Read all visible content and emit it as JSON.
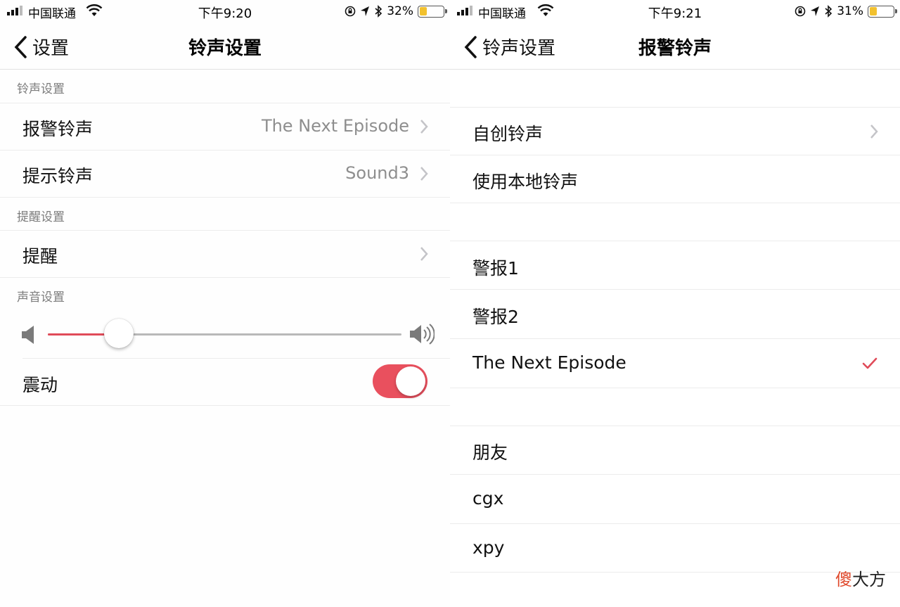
{
  "left": {
    "status": {
      "carrier": "中国联通",
      "time": "下午9:20",
      "battery": "32%",
      "battery_level": 0.32
    },
    "nav": {
      "back_label": "设置",
      "title": "铃声设置"
    },
    "sections": {
      "ringtone_header": "铃声设置",
      "reminder_header": "提醒设置",
      "sound_header": "声音设置"
    },
    "rows": {
      "alarm_label": "报警铃声",
      "alarm_value": "The Next Episode",
      "prompt_label": "提示铃声",
      "prompt_value": "Sound3",
      "reminder_label": "提醒",
      "vibrate_label": "震动"
    },
    "volume_level": 0.2,
    "vibrate_on": true
  },
  "right": {
    "status": {
      "carrier": "中国联通",
      "time": "下午9:21",
      "battery": "31%",
      "battery_level": 0.31
    },
    "nav": {
      "back_label": "铃声设置",
      "title": "报警铃声"
    },
    "group1": {
      "custom": "自创铃声",
      "local": "使用本地铃声"
    },
    "group2": [
      "警报1",
      "警报2",
      "The Next Episode"
    ],
    "selected": "The Next Episode",
    "group3": [
      "朋友",
      "cgx",
      "xpy"
    ]
  },
  "watermark": {
    "first": "傻",
    "rest": "大方"
  },
  "colors": {
    "accent": "#e04b59",
    "battery": "#f2c12e"
  }
}
